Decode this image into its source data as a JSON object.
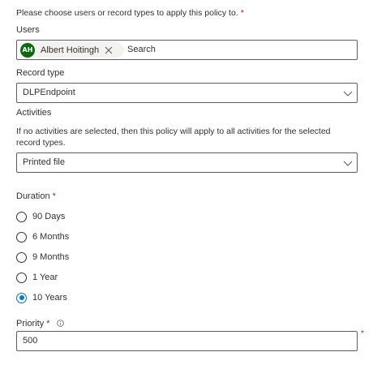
{
  "header": {
    "instruction": "Please choose users or record types to apply this policy to.",
    "required_mark": "*"
  },
  "users": {
    "label": "Users",
    "selected": [
      {
        "initials": "AH",
        "name": "Albert Hoitingh",
        "avatar_color": "#0b6a0b"
      }
    ],
    "search_placeholder": "Search"
  },
  "record_type": {
    "label": "Record type",
    "value": "DLPEndpoint"
  },
  "activities": {
    "label": "Activities",
    "help": "If no activities are selected, then this policy will apply to all activities for the selected record types.",
    "value": "Printed file"
  },
  "duration": {
    "label": "Duration",
    "required_mark": "*",
    "options": [
      {
        "label": "90 Days",
        "checked": false
      },
      {
        "label": "6 Months",
        "checked": false
      },
      {
        "label": "9 Months",
        "checked": false
      },
      {
        "label": "1 Year",
        "checked": false
      },
      {
        "label": "10 Years",
        "checked": true
      }
    ]
  },
  "priority": {
    "label": "Priority",
    "required_mark": "*",
    "value": "500",
    "info_icon": "info-icon"
  },
  "colors": {
    "accent": "#0078d4",
    "required": "#a4262c",
    "avatar": "#0b6a0b"
  }
}
